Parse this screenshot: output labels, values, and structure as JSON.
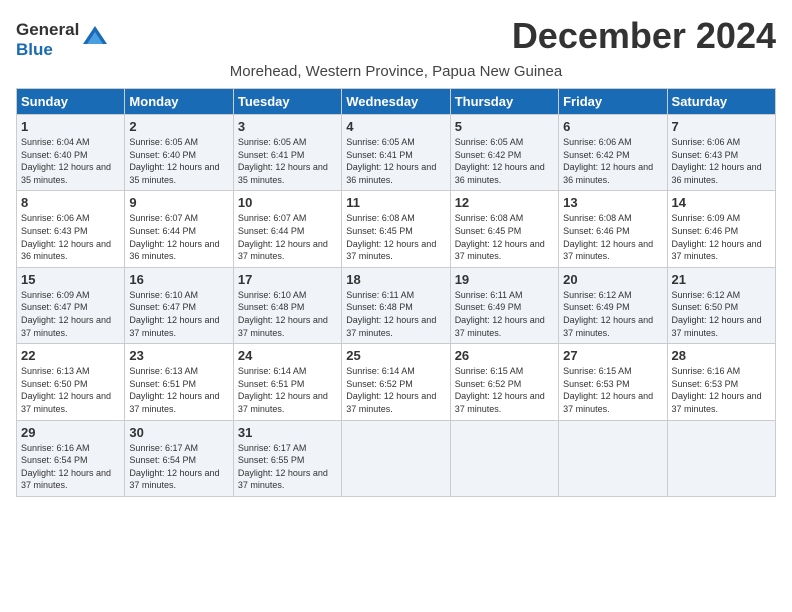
{
  "header": {
    "logo_line1": "General",
    "logo_line2": "Blue",
    "month_title": "December 2024",
    "subtitle": "Morehead, Western Province, Papua New Guinea"
  },
  "days_of_week": [
    "Sunday",
    "Monday",
    "Tuesday",
    "Wednesday",
    "Thursday",
    "Friday",
    "Saturday"
  ],
  "weeks": [
    [
      {
        "day": "1",
        "sunrise": "6:04 AM",
        "sunset": "6:40 PM",
        "daylight": "12 hours and 35 minutes."
      },
      {
        "day": "2",
        "sunrise": "6:05 AM",
        "sunset": "6:40 PM",
        "daylight": "12 hours and 35 minutes."
      },
      {
        "day": "3",
        "sunrise": "6:05 AM",
        "sunset": "6:41 PM",
        "daylight": "12 hours and 35 minutes."
      },
      {
        "day": "4",
        "sunrise": "6:05 AM",
        "sunset": "6:41 PM",
        "daylight": "12 hours and 36 minutes."
      },
      {
        "day": "5",
        "sunrise": "6:05 AM",
        "sunset": "6:42 PM",
        "daylight": "12 hours and 36 minutes."
      },
      {
        "day": "6",
        "sunrise": "6:06 AM",
        "sunset": "6:42 PM",
        "daylight": "12 hours and 36 minutes."
      },
      {
        "day": "7",
        "sunrise": "6:06 AM",
        "sunset": "6:43 PM",
        "daylight": "12 hours and 36 minutes."
      }
    ],
    [
      {
        "day": "8",
        "sunrise": "6:06 AM",
        "sunset": "6:43 PM",
        "daylight": "12 hours and 36 minutes."
      },
      {
        "day": "9",
        "sunrise": "6:07 AM",
        "sunset": "6:44 PM",
        "daylight": "12 hours and 36 minutes."
      },
      {
        "day": "10",
        "sunrise": "6:07 AM",
        "sunset": "6:44 PM",
        "daylight": "12 hours and 37 minutes."
      },
      {
        "day": "11",
        "sunrise": "6:08 AM",
        "sunset": "6:45 PM",
        "daylight": "12 hours and 37 minutes."
      },
      {
        "day": "12",
        "sunrise": "6:08 AM",
        "sunset": "6:45 PM",
        "daylight": "12 hours and 37 minutes."
      },
      {
        "day": "13",
        "sunrise": "6:08 AM",
        "sunset": "6:46 PM",
        "daylight": "12 hours and 37 minutes."
      },
      {
        "day": "14",
        "sunrise": "6:09 AM",
        "sunset": "6:46 PM",
        "daylight": "12 hours and 37 minutes."
      }
    ],
    [
      {
        "day": "15",
        "sunrise": "6:09 AM",
        "sunset": "6:47 PM",
        "daylight": "12 hours and 37 minutes."
      },
      {
        "day": "16",
        "sunrise": "6:10 AM",
        "sunset": "6:47 PM",
        "daylight": "12 hours and 37 minutes."
      },
      {
        "day": "17",
        "sunrise": "6:10 AM",
        "sunset": "6:48 PM",
        "daylight": "12 hours and 37 minutes."
      },
      {
        "day": "18",
        "sunrise": "6:11 AM",
        "sunset": "6:48 PM",
        "daylight": "12 hours and 37 minutes."
      },
      {
        "day": "19",
        "sunrise": "6:11 AM",
        "sunset": "6:49 PM",
        "daylight": "12 hours and 37 minutes."
      },
      {
        "day": "20",
        "sunrise": "6:12 AM",
        "sunset": "6:49 PM",
        "daylight": "12 hours and 37 minutes."
      },
      {
        "day": "21",
        "sunrise": "6:12 AM",
        "sunset": "6:50 PM",
        "daylight": "12 hours and 37 minutes."
      }
    ],
    [
      {
        "day": "22",
        "sunrise": "6:13 AM",
        "sunset": "6:50 PM",
        "daylight": "12 hours and 37 minutes."
      },
      {
        "day": "23",
        "sunrise": "6:13 AM",
        "sunset": "6:51 PM",
        "daylight": "12 hours and 37 minutes."
      },
      {
        "day": "24",
        "sunrise": "6:14 AM",
        "sunset": "6:51 PM",
        "daylight": "12 hours and 37 minutes."
      },
      {
        "day": "25",
        "sunrise": "6:14 AM",
        "sunset": "6:52 PM",
        "daylight": "12 hours and 37 minutes."
      },
      {
        "day": "26",
        "sunrise": "6:15 AM",
        "sunset": "6:52 PM",
        "daylight": "12 hours and 37 minutes."
      },
      {
        "day": "27",
        "sunrise": "6:15 AM",
        "sunset": "6:53 PM",
        "daylight": "12 hours and 37 minutes."
      },
      {
        "day": "28",
        "sunrise": "6:16 AM",
        "sunset": "6:53 PM",
        "daylight": "12 hours and 37 minutes."
      }
    ],
    [
      {
        "day": "29",
        "sunrise": "6:16 AM",
        "sunset": "6:54 PM",
        "daylight": "12 hours and 37 minutes."
      },
      {
        "day": "30",
        "sunrise": "6:17 AM",
        "sunset": "6:54 PM",
        "daylight": "12 hours and 37 minutes."
      },
      {
        "day": "31",
        "sunrise": "6:17 AM",
        "sunset": "6:55 PM",
        "daylight": "12 hours and 37 minutes."
      },
      null,
      null,
      null,
      null
    ]
  ]
}
